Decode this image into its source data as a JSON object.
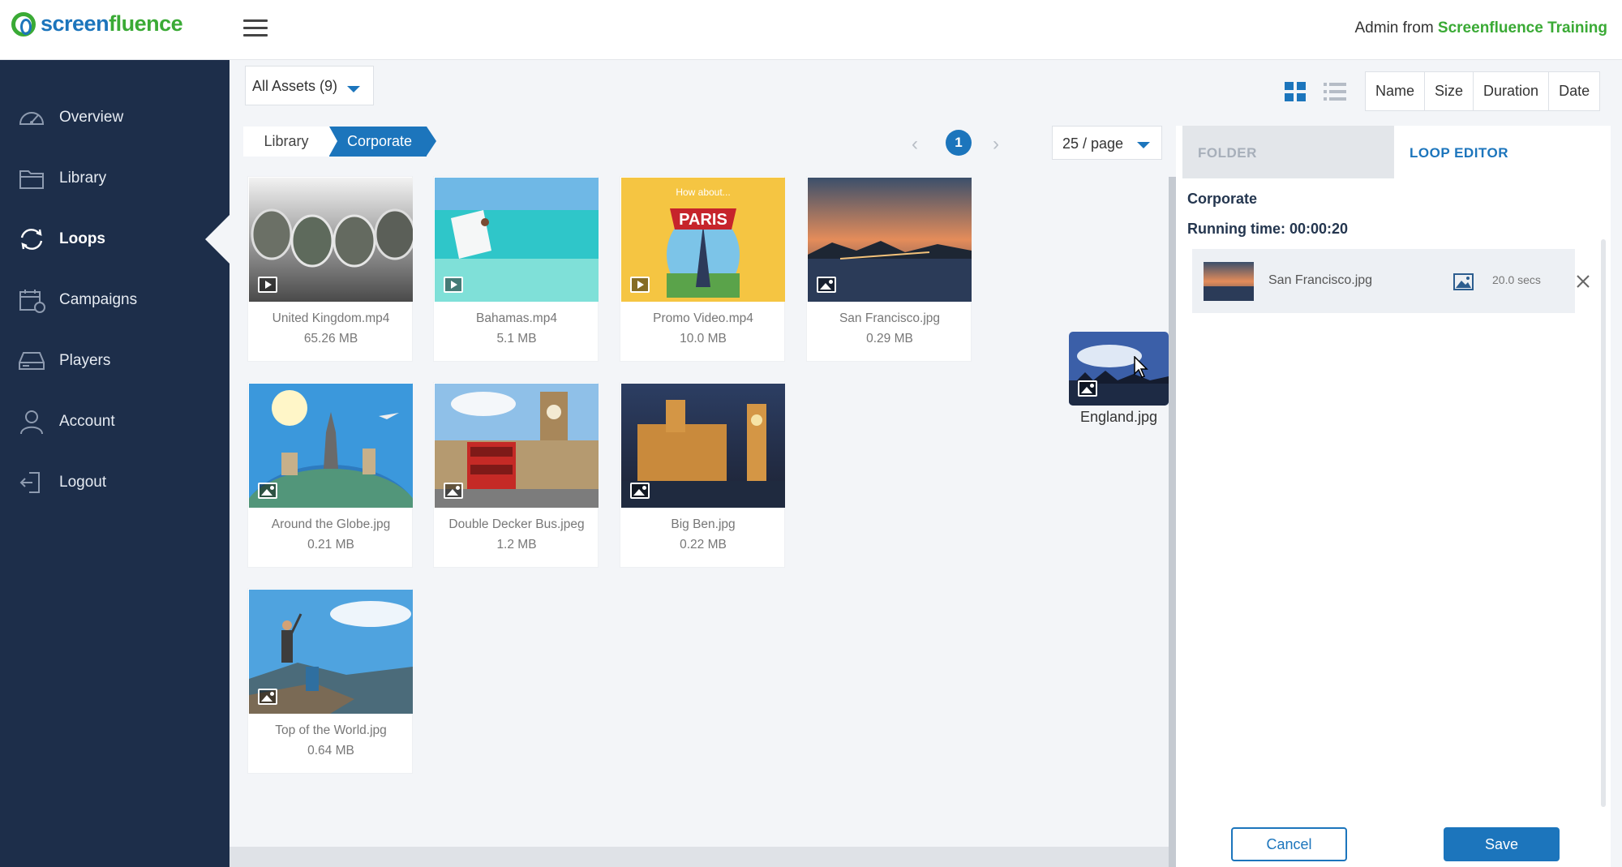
{
  "brand": {
    "name_part1": "screen",
    "name_part2": "fluence"
  },
  "user": {
    "name": "Admin",
    "from": "from",
    "org": "Screenfluence Training"
  },
  "sidebar": {
    "items": [
      {
        "label": "Overview",
        "icon": "speedometer-icon"
      },
      {
        "label": "Library",
        "icon": "folder-icon"
      },
      {
        "label": "Loops",
        "icon": "loop-icon",
        "active": true
      },
      {
        "label": "Campaigns",
        "icon": "calendar-icon"
      },
      {
        "label": "Players",
        "icon": "player-icon"
      },
      {
        "label": "Account",
        "icon": "user-icon"
      },
      {
        "label": "Logout",
        "icon": "logout-icon"
      }
    ]
  },
  "filter": {
    "label": "All Assets (9)"
  },
  "sort": {
    "name": "Name",
    "size": "Size",
    "duration": "Duration",
    "date": "Date"
  },
  "breadcrumb": {
    "root": "Library",
    "current": "Corporate"
  },
  "pagination": {
    "current": "1",
    "per_page": "25 / page"
  },
  "assets": [
    {
      "name": "United Kingdom.mp4",
      "size": "65.26 MB",
      "type": "video"
    },
    {
      "name": "Bahamas.mp4",
      "size": "5.1 MB",
      "type": "video"
    },
    {
      "name": "Promo Video.mp4",
      "size": "10.0 MB",
      "type": "video",
      "thumb_text_1": "How about...",
      "thumb_text_2": "PARIS"
    },
    {
      "name": "San Francisco.jpg",
      "size": "0.29 MB",
      "type": "image"
    },
    {
      "name": "Around the Globe.jpg",
      "size": "0.21 MB",
      "type": "image"
    },
    {
      "name": "Double Decker Bus.jpeg",
      "size": "1.2 MB",
      "type": "image"
    },
    {
      "name": "Big Ben.jpg",
      "size": "0.22 MB",
      "type": "image"
    },
    {
      "name": "Top of the World.jpg",
      "size": "0.64 MB",
      "type": "image"
    }
  ],
  "dragging": {
    "name": "England.jpg"
  },
  "panel": {
    "tab_folder": "FOLDER",
    "tab_loop_editor": "LOOP EDITOR",
    "loop_name": "Corporate",
    "running_time": "Running time: 00:00:20",
    "items": [
      {
        "name": "San Francisco.jpg",
        "duration": "20.0 secs"
      }
    ],
    "cancel_label": "Cancel",
    "save_label": "Save"
  },
  "colors": {
    "accent": "#1c75bc",
    "brand_green": "#3aaa35",
    "sidebar": "#1d2e4a"
  }
}
